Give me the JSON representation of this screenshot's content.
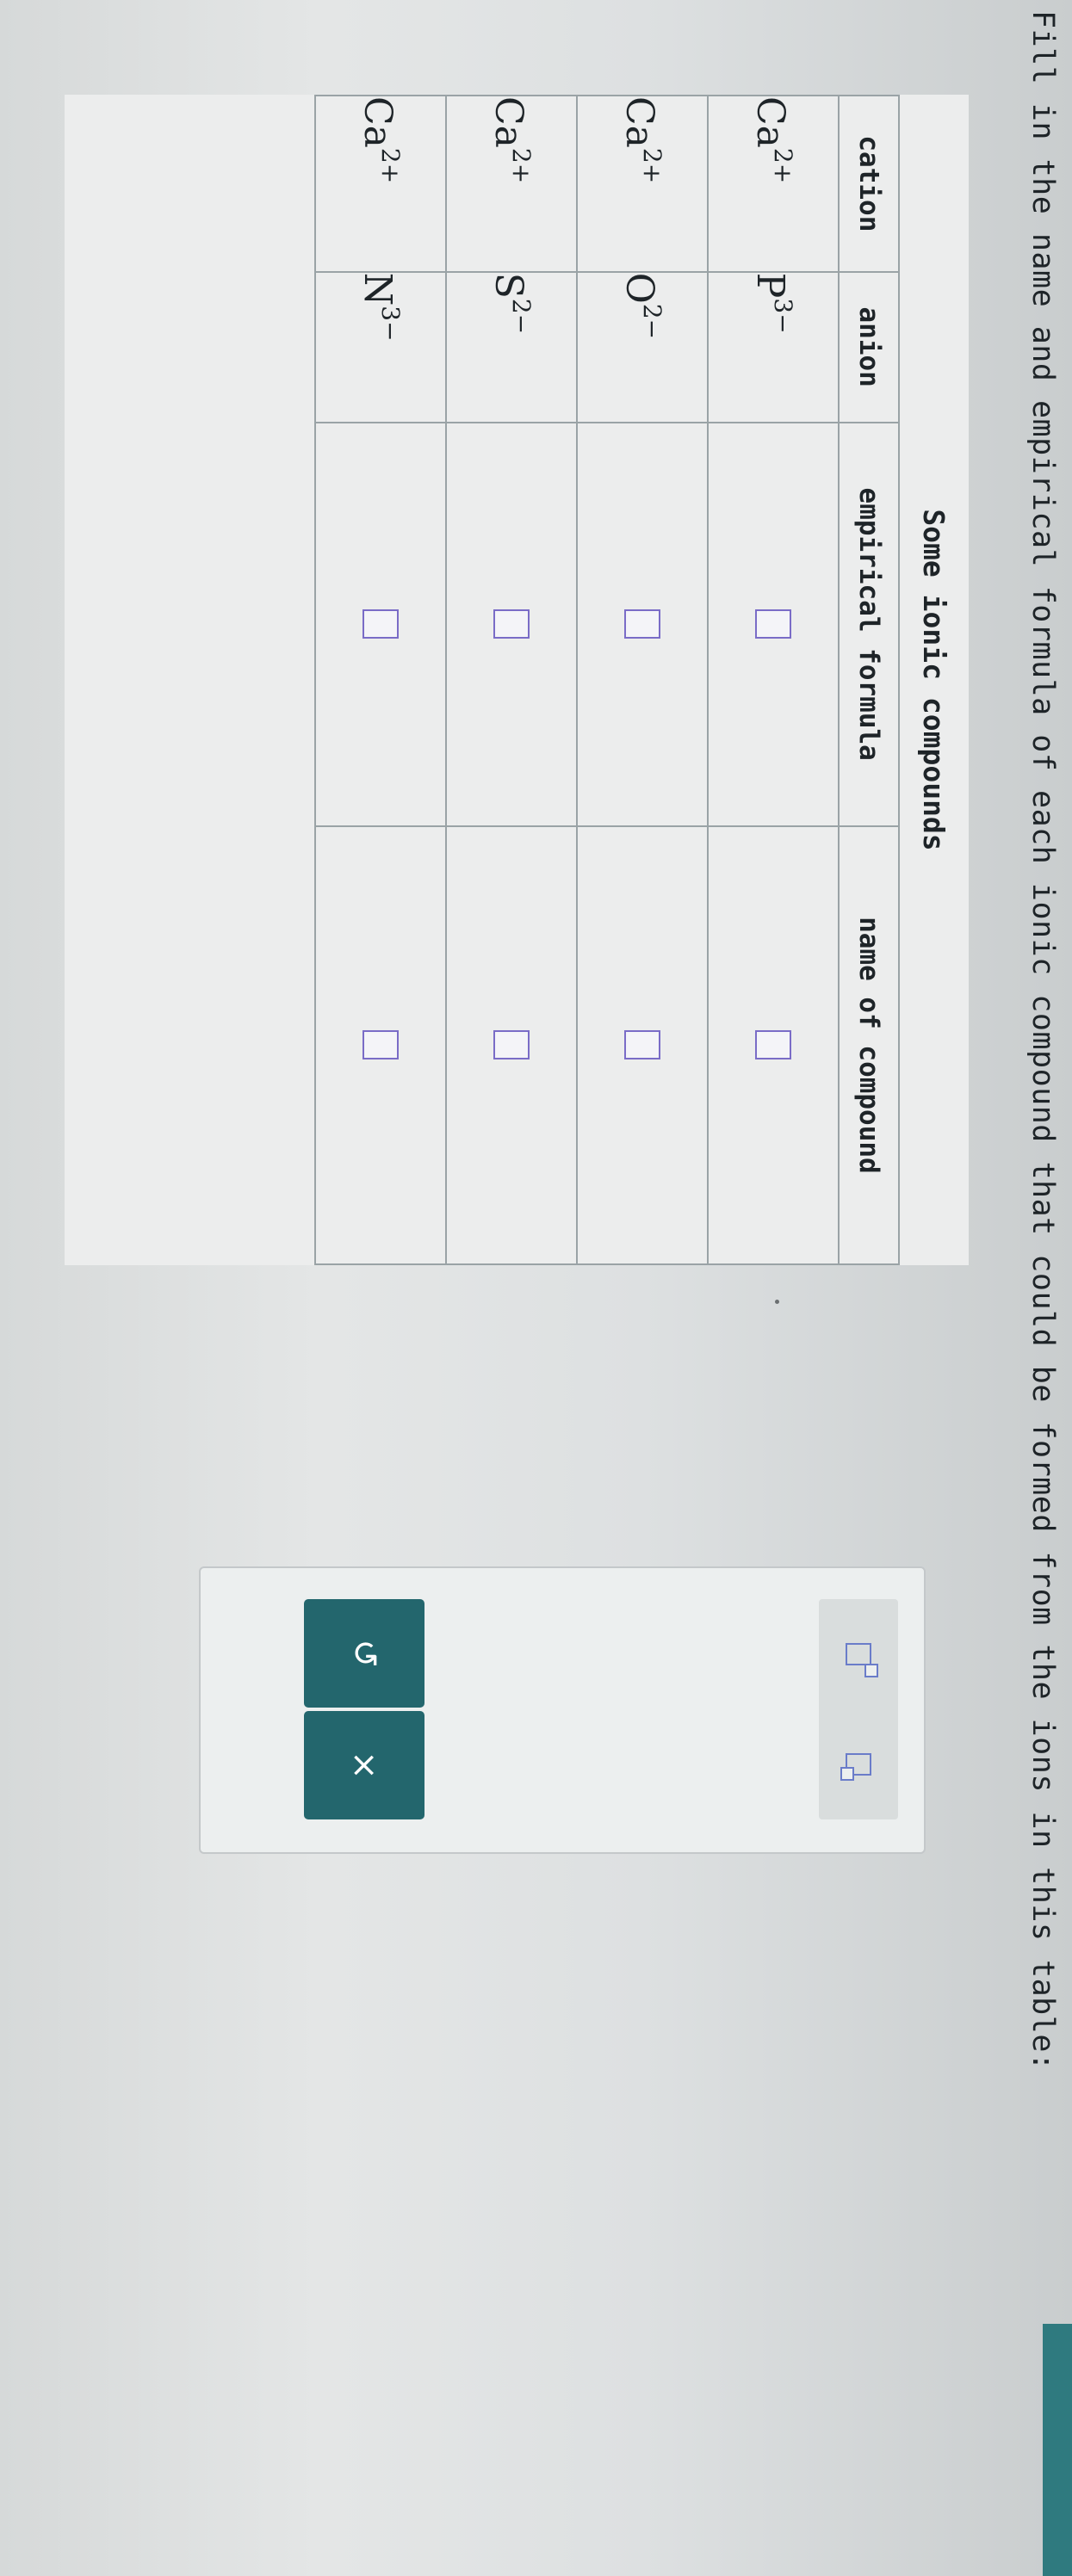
{
  "instruction": "Fill in the name and empirical formula of each ionic compound that could be formed from the ions in this table:",
  "table": {
    "title": "Some ionic compounds",
    "headers": [
      "cation",
      "anion",
      "empirical formula",
      "name of compound"
    ],
    "rows": [
      {
        "cation": "Ca",
        "cation_charge": "2+",
        "anion": "P",
        "anion_charge": "3−"
      },
      {
        "cation": "Ca",
        "cation_charge": "2+",
        "anion": "O",
        "anion_charge": "2−"
      },
      {
        "cation": "Ca",
        "cation_charge": "2+",
        "anion": "S",
        "anion_charge": "2−"
      },
      {
        "cation": "Ca",
        "cation_charge": "2+",
        "anion": "N",
        "anion_charge": "3−"
      }
    ]
  },
  "tools": {
    "superscript_icon": "superscript-box-icon",
    "subscript_icon": "subscript-box-icon",
    "undo_label": "↺",
    "clear_label": "×"
  },
  "colors": {
    "button_bg": "#23666d",
    "blank_border": "#7a6cc7",
    "teal_edge": "#2f7a7f"
  }
}
